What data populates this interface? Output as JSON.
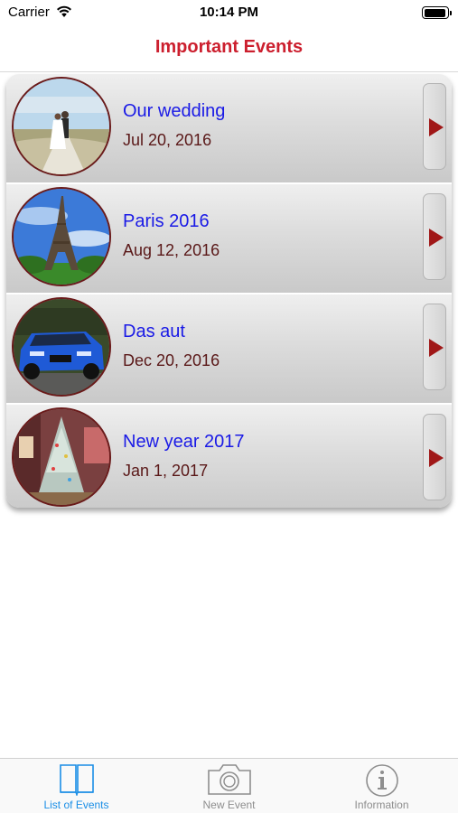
{
  "status_bar": {
    "carrier": "Carrier",
    "time": "10:14 PM",
    "battery_level": 0.95
  },
  "nav": {
    "title": "Important Events"
  },
  "events": [
    {
      "title": "Our wedding",
      "date": "Jul 20, 2016",
      "image": "wedding-photo"
    },
    {
      "title": "Paris 2016",
      "date": "Aug 12, 2016",
      "image": "eiffel-tower-photo"
    },
    {
      "title": "Das aut",
      "date": "Dec 20, 2016",
      "image": "blue-car-photo"
    },
    {
      "title": "New year 2017",
      "date": "Jan 1, 2017",
      "image": "christmas-tree-photo"
    }
  ],
  "tabs": [
    {
      "label": "List of Events",
      "icon": "book-icon",
      "active": true
    },
    {
      "label": "New Event",
      "icon": "camera-icon",
      "active": false
    },
    {
      "label": "Information",
      "icon": "info-icon",
      "active": false
    }
  ],
  "colors": {
    "nav_title": "#cc1f2e",
    "event_title": "#1a1ae6",
    "event_date": "#5a1818",
    "tab_active": "#1a8ee6",
    "tab_inactive": "#8e8e8e",
    "arrow": "#a01818"
  }
}
